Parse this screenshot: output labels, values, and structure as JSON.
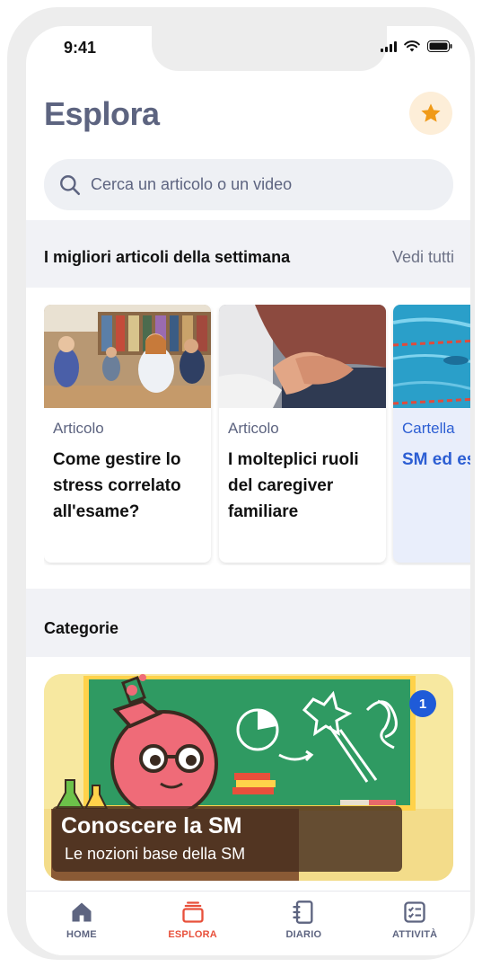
{
  "status_bar": {
    "time": "9:41"
  },
  "header": {
    "title": "Esplora",
    "favorites_icon": "star-icon"
  },
  "search": {
    "placeholder": "Cerca un articolo o un video",
    "icon": "search-icon"
  },
  "top_articles": {
    "title": "I migliori articoli della settimana",
    "see_all": "Vedi tutti",
    "cards": [
      {
        "type": "Articolo",
        "title": "Come gestire lo stress correlato all'esame?",
        "image": "students-in-classroom-photo"
      },
      {
        "type": "Articolo",
        "title": "I molteplici ruoli del caregiver familiare",
        "image": "holding-hands-photo"
      },
      {
        "type": "Cartella",
        "title": "SM ed esercizi",
        "image": "swimming-pool-photo"
      }
    ]
  },
  "categories": {
    "title": "Categorie",
    "items": [
      {
        "title": "Conoscere la SM",
        "subtitle": "Le nozioni base della SM",
        "badge": "1",
        "image": "chalkboard-flask-illustration"
      }
    ]
  },
  "tabbar": {
    "items": [
      {
        "label": "HOME",
        "icon": "home-icon",
        "active": false
      },
      {
        "label": "ESPLORA",
        "icon": "explore-icon",
        "active": true
      },
      {
        "label": "DIARIO",
        "icon": "diary-icon",
        "active": false
      },
      {
        "label": "ATTIVITÀ",
        "icon": "activities-icon",
        "active": false
      }
    ]
  },
  "colors": {
    "title": "#5d6480",
    "accent_active": "#e8503b",
    "star": "#f09a18",
    "badge": "#1f5bd8",
    "folder_text": "#2c5ed3",
    "section_band": "#f1f2f6"
  }
}
